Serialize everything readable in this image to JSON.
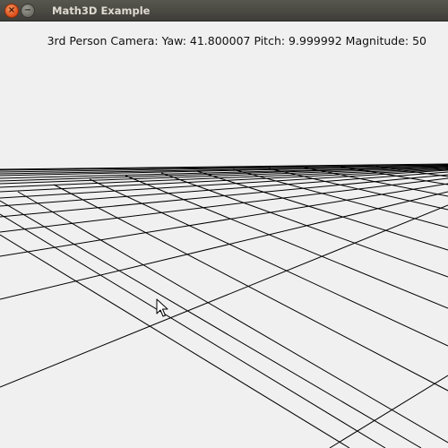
{
  "window": {
    "title": "Math3D Example",
    "close_glyph": "×",
    "minimize_glyph": "−"
  },
  "hud": {
    "camera_status": "3rd Person Camera: Yaw: 41.800007 Pitch: 9.999992 Magnitude: 50"
  },
  "icons": {
    "close": "close-icon",
    "minimize": "minimize-icon",
    "cursor": "mouse-pointer-icon"
  },
  "colors": {
    "titlebar": "#4a4944",
    "title_text": "#dfdbd2",
    "close_button": "#e5591f",
    "canvas_background": "#f0f0f0",
    "grid_lines": "#000000",
    "hud_text": "#111111"
  }
}
